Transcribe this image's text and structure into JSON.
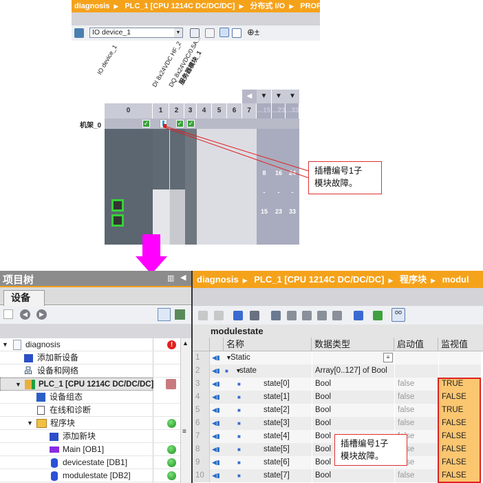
{
  "top": {
    "breadcrumb": [
      "diagnosis",
      "PLC_1 [CPU 1214C DC/DC/DC]",
      "分布式 I/O",
      "PROFINET IO"
    ],
    "device_select": "IO device_1",
    "module_labels": [
      "IO device_1",
      "DI 8x24VDC HF_2",
      "DQ 8x24VDC/0.5A...",
      "服务器模块_1"
    ],
    "slots": [
      "0",
      "1",
      "2",
      "3",
      "4",
      "5",
      "6",
      "7",
      "...15",
      "...23",
      "...33"
    ],
    "rack_label": "机架_0",
    "range_cols": [
      [
        "8",
        "-",
        "15"
      ],
      [
        "16",
        "-",
        "23"
      ],
      [
        "24",
        "-",
        "33"
      ]
    ],
    "callout": [
      "插槽编号1子",
      "模块故障。"
    ]
  },
  "project_tree": {
    "title": "项目树",
    "tab": "设备",
    "items": [
      {
        "label": "diagnosis",
        "status": "error"
      },
      {
        "label": "添加新设备",
        "status": ""
      },
      {
        "label": "设备和网络",
        "status": ""
      },
      {
        "label": "PLC_1 [CPU 1214C DC/DC/DC]",
        "status": "fault"
      },
      {
        "label": "设备组态",
        "status": ""
      },
      {
        "label": "在线和诊断",
        "status": ""
      },
      {
        "label": "程序块",
        "status": "ok"
      },
      {
        "label": "添加新块",
        "status": ""
      },
      {
        "label": "Main [OB1]",
        "status": "ok"
      },
      {
        "label": "devicestate [DB1]",
        "status": "ok"
      },
      {
        "label": "modulestate [DB2]",
        "status": "ok"
      }
    ]
  },
  "editor": {
    "breadcrumb": [
      "diagnosis",
      "PLC_1 [CPU 1214C DC/DC/DC]",
      "程序块",
      "modul"
    ],
    "block_name": "modulestate",
    "columns": [
      "名称",
      "数据类型",
      "启动值",
      "监视值"
    ],
    "rows": [
      {
        "n": "1",
        "name": "Static",
        "type": "",
        "start": "",
        "monitor": ""
      },
      {
        "n": "2",
        "name": "state",
        "type": "Array[0..127] of Bool",
        "start": "",
        "monitor": ""
      },
      {
        "n": "3",
        "name": "state[0]",
        "type": "Bool",
        "start": "false",
        "monitor": "TRUE"
      },
      {
        "n": "4",
        "name": "state[1]",
        "type": "Bool",
        "start": "false",
        "monitor": "FALSE"
      },
      {
        "n": "5",
        "name": "state[2]",
        "type": "Bool",
        "start": "false",
        "monitor": "TRUE"
      },
      {
        "n": "6",
        "name": "state[3]",
        "type": "Bool",
        "start": "false",
        "monitor": "FALSE"
      },
      {
        "n": "7",
        "name": "state[4]",
        "type": "Bool",
        "start": "false",
        "monitor": "FALSE"
      },
      {
        "n": "8",
        "name": "state[5]",
        "type": "Bool",
        "start": "false",
        "monitor": "FALSE"
      },
      {
        "n": "9",
        "name": "state[6]",
        "type": "Bool",
        "start": "false",
        "monitor": "FALSE"
      },
      {
        "n": "10",
        "name": "state[7]",
        "type": "Bool",
        "start": "false",
        "monitor": "FALSE"
      }
    ],
    "callout": [
      "插槽编号1子",
      "模块故障。"
    ]
  },
  "colors": {
    "accent": "#f5a21b",
    "monitor_bg": "#fbc670",
    "highlight": "#e02020",
    "arrow": "#ff00ff"
  }
}
